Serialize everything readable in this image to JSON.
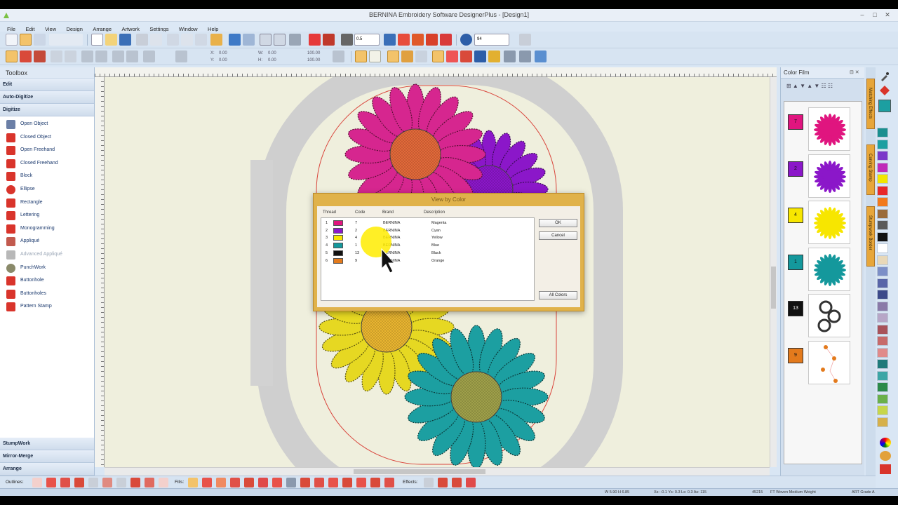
{
  "window": {
    "title": "BERNINA Embroidery Software DesignerPlus - [Design1]",
    "controls": [
      "–",
      "□",
      "✕"
    ]
  },
  "menu": [
    "File",
    "Edit",
    "View",
    "Design",
    "Arrange",
    "Artwork",
    "Settings",
    "Window",
    "Help"
  ],
  "toolbar": {
    "zoom_value": "94",
    "stitch_value": "0.5",
    "x_label": "X:",
    "x_value": "0.00",
    "y_label": "Y:",
    "y_value": "0.00",
    "w_label": "W:",
    "w_value": "0.00",
    "h_label": "H:",
    "h_value": "0.00",
    "pct1": "100.00",
    "pct2": "100.00"
  },
  "toolbox": {
    "title": "Toolbox",
    "categories_top": [
      "Edit",
      "Auto-Digitize",
      "Digitize"
    ],
    "tools": [
      {
        "label": "Open Object",
        "icon": "open-object-icon",
        "color": "#6b7fa6",
        "disabled": false
      },
      {
        "label": "Closed Object",
        "icon": "closed-object-icon",
        "color": "#d9342b",
        "disabled": false
      },
      {
        "label": "Open Freehand",
        "icon": "open-freehand-icon",
        "color": "#d9342b",
        "disabled": false
      },
      {
        "label": "Closed Freehand",
        "icon": "closed-freehand-icon",
        "color": "#d9342b",
        "disabled": false
      },
      {
        "label": "Block",
        "icon": "block-icon",
        "color": "#d9342b",
        "disabled": false
      },
      {
        "label": "Ellipse",
        "icon": "ellipse-icon",
        "color": "#d9342b",
        "disabled": false
      },
      {
        "label": "Rectangle",
        "icon": "rectangle-icon",
        "color": "#d9342b",
        "disabled": false
      },
      {
        "label": "Lettering",
        "icon": "lettering-icon",
        "color": "#d9342b",
        "disabled": false
      },
      {
        "label": "Monogramming",
        "icon": "monogramming-icon",
        "color": "#d9342b",
        "disabled": false
      },
      {
        "label": "Appliqué",
        "icon": "applique-icon",
        "color": "#c25a4e",
        "disabled": false
      },
      {
        "label": "Advanced Appliqué",
        "icon": "advanced-applique-icon",
        "color": "#b8b8b8",
        "disabled": true
      },
      {
        "label": "PunchWork",
        "icon": "punchwork-icon",
        "color": "#8a8a6a",
        "disabled": false
      },
      {
        "label": "Buttonhole",
        "icon": "buttonhole-icon",
        "color": "#d9342b",
        "disabled": false
      },
      {
        "label": "Buttonholes",
        "icon": "buttonholes-icon",
        "color": "#d9342b",
        "disabled": false
      },
      {
        "label": "Pattern Stamp",
        "icon": "pattern-stamp-icon",
        "color": "#d9342b",
        "disabled": false
      }
    ],
    "categories_bottom": [
      "StumpWork",
      "Mirror-Merge",
      "Arrange"
    ]
  },
  "dialog": {
    "title": "View by Color",
    "headers": {
      "thread": "Thread",
      "code": "Code",
      "brand": "Brand",
      "description": "Description"
    },
    "rows": [
      {
        "num": "1",
        "code": "7",
        "brand": "BERNINA",
        "desc": "Magenta",
        "color": "#e0157f"
      },
      {
        "num": "2",
        "code": "2",
        "brand": "BERNINA",
        "desc": "Cyan",
        "color": "#8b17c9"
      },
      {
        "num": "3",
        "code": "4",
        "brand": "BERNINA",
        "desc": "Yellow",
        "color": "#f7e600"
      },
      {
        "num": "4",
        "code": "1",
        "brand": "BERNINA",
        "desc": "Blue",
        "color": "#14989c"
      },
      {
        "num": "5",
        "code": "13",
        "brand": "BERNINA",
        "desc": "Black",
        "color": "#111111"
      },
      {
        "num": "6",
        "code": "9",
        "brand": "BERNINA",
        "desc": "Orange",
        "color": "#e37a1c"
      }
    ],
    "ok_label": "OK",
    "cancel_label": "Cancel",
    "all_colors_label": "All Colors"
  },
  "color_film": {
    "title": "Color Film",
    "items": [
      {
        "badge": "7",
        "color": "#e0157f",
        "thumb": "magenta"
      },
      {
        "badge": "2",
        "color": "#8b17c9",
        "thumb": "purple"
      },
      {
        "badge": "4",
        "color": "#f7e600",
        "thumb": "yellow"
      },
      {
        "badge": "1",
        "color": "#14989c",
        "thumb": "teal"
      },
      {
        "badge": "13",
        "color": "#111111",
        "thumb": "black"
      },
      {
        "badge": "9",
        "color": "#e37a1c",
        "thumb": "orange"
      }
    ]
  },
  "side_tabs": [
    "Matching Effects",
    "Carving Stamp",
    "Stumpwork Border"
  ],
  "palette": [
    "#1a8f8f",
    "#1c9fa1",
    "#7a38c9",
    "#c02ab8",
    "#f2e600",
    "#e8282a",
    "#f27a1c",
    "#9a6b3a",
    "#5a5a5a",
    "#111111",
    "#ffffff",
    "#e8d8b8",
    "#7c8fc7",
    "#5865a8",
    "#3c4a8a",
    "#8a7aa8",
    "#b7a6c7",
    "#a8525a",
    "#c76a6a",
    "#e08a8a",
    "#1e7a7a",
    "#3ca6a6",
    "#2c8a4a",
    "#6ab04a",
    "#c7d64a",
    "#d6b04a"
  ],
  "bottom": {
    "outlines_label": "Outlines:",
    "fills_label": "Fills:",
    "effects_label": "Effects:"
  },
  "status": {
    "size": "W 5.90 H 6.85",
    "coords": "Xs: -0.1 Ys: 0.3 Ls: 0.3 As: 115",
    "stitches": "45215",
    "fabric": "FT Woven Medium Weight",
    "grade": "ART Grade A"
  }
}
